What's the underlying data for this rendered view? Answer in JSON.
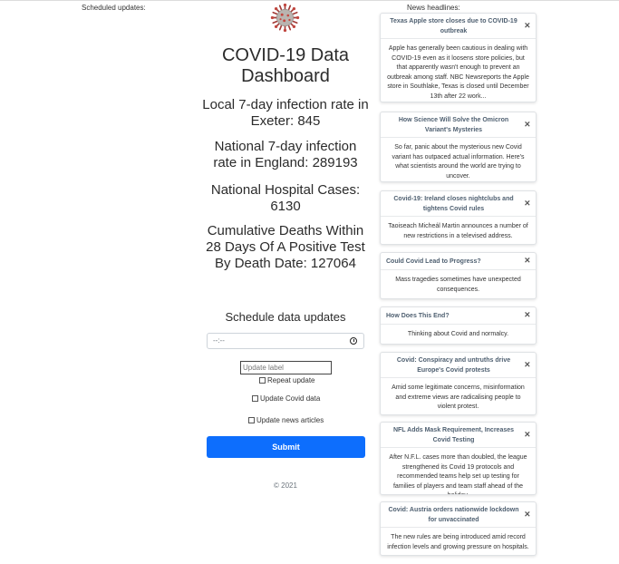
{
  "page": {
    "scheduled_updates_label": "Scheduled updates:",
    "news_headlines_label": "News headlines:"
  },
  "dashboard": {
    "title": "COVID-19 Data Dashboard",
    "local_rate": "Local 7-day infection rate in Exeter: 845",
    "national_rate": "National 7-day infection rate in England: 289193",
    "hospital_cases": "National Hospital Cases: 6130",
    "deaths": "Cumulative Deaths Within 28 Days Of A Positive Test By Death Date: 127064"
  },
  "schedule": {
    "title": "Schedule data updates",
    "time_value": "--:--",
    "label_placeholder": "Update label",
    "repeat_label": "Repeat update",
    "covid_label": "Update Covid data",
    "news_label": "Update news articles",
    "submit_label": "Submit",
    "repeat_checked": false,
    "covid_checked": false,
    "news_checked": false
  },
  "footer": {
    "text": "© 2021"
  },
  "news": [
    {
      "title": "Texas Apple store closes due to COVID-19 outbreak",
      "body": "Apple has generally been cautious in dealing with COVID-19 even as it loosens store policies, but that apparently wasn't enough to prevent an outbreak among staff. NBC Newsreports the Apple store in Southlake, Texas is closed until December 13th after 22 work..."
    },
    {
      "title": "How Science Will Solve the Omicron Variant's Mysteries",
      "body": "So far, panic about the mysterious new Covid variant has outpaced actual information. Here's what scientists around the world are trying to uncover."
    },
    {
      "title": "Covid-19: Ireland closes nightclubs and tightens Covid rules",
      "body": "Taoiseach Micheál Martin announces a number of new restrictions in a televised address."
    },
    {
      "title": "Could Covid Lead to Progress?",
      "body": "Mass tragedies sometimes have unexpected consequences."
    },
    {
      "title": "How Does This End?",
      "body": "Thinking about Covid and normalcy."
    },
    {
      "title": "Covid: Conspiracy and untruths drive Europe's Covid protests",
      "body": "Amid some legitimate concerns, misinformation and extreme views are radicalising people to violent protest."
    },
    {
      "title": "NFL Adds Mask Requirement, Increases Covid Testing",
      "body": "After N.F.L. cases more than doubled, the league strengthened its Covid 19 protocols and recommended teams help set up testing for families of players and team staff ahead of the holiday."
    },
    {
      "title": "Covid: Austria orders nationwide lockdown for unvaccinated",
      "body": "The new rules are being introduced amid record infection levels and growing pressure on hospitals."
    }
  ],
  "close_glyph": "×",
  "colors": {
    "submit": "#0d6efd",
    "toast_title": "#4e5f70"
  },
  "icons": {
    "logo": "coronavirus-icon",
    "time": "clock-icon",
    "dismiss": "close-icon"
  }
}
